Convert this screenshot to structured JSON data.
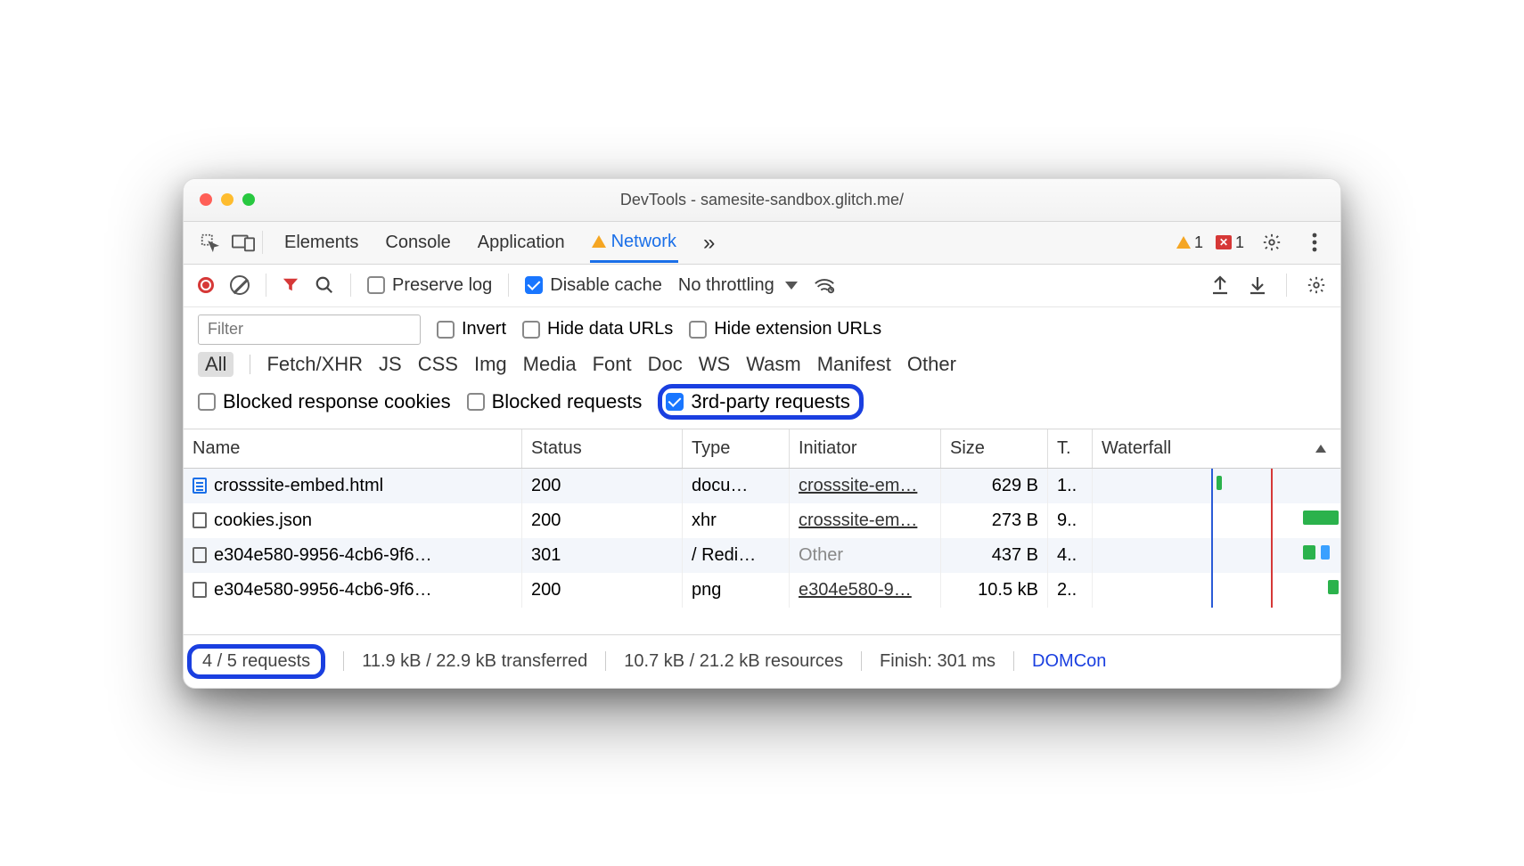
{
  "window": {
    "title": "DevTools - samesite-sandbox.glitch.me/"
  },
  "tabs": {
    "items": [
      "Elements",
      "Console",
      "Application",
      "Network"
    ],
    "active": 3,
    "overflow": "»"
  },
  "tabbar_status": {
    "warn_count": "1",
    "error_count": "1"
  },
  "toolbar": {
    "preserve_log": "Preserve log",
    "disable_cache": "Disable cache",
    "throttling": "No throttling"
  },
  "filterbar": {
    "placeholder": "Filter",
    "invert": "Invert",
    "hide_data": "Hide data URLs",
    "hide_ext": "Hide extension URLs"
  },
  "type_filters": [
    "All",
    "Fetch/XHR",
    "JS",
    "CSS",
    "Img",
    "Media",
    "Font",
    "Doc",
    "WS",
    "Wasm",
    "Manifest",
    "Other"
  ],
  "advanced_filters": {
    "blocked_cookies": "Blocked response cookies",
    "blocked_requests": "Blocked requests",
    "third_party": "3rd-party requests"
  },
  "columns": {
    "name": "Name",
    "status": "Status",
    "type": "Type",
    "initiator": "Initiator",
    "size": "Size",
    "time": "T.",
    "waterfall": "Waterfall"
  },
  "rows": [
    {
      "icon": "doc",
      "name": "crosssite-embed.html",
      "status": "200",
      "type": "docu…",
      "initiator": "crosssite-em…",
      "initiator_link": true,
      "size": "629 B",
      "time": "1.."
    },
    {
      "icon": "blank",
      "name": "cookies.json",
      "status": "200",
      "type": "xhr",
      "initiator": "crosssite-em…",
      "initiator_link": true,
      "size": "273 B",
      "time": "9.."
    },
    {
      "icon": "blank",
      "name": "e304e580-9956-4cb6-9f6…",
      "status": "301",
      "type": "/ Redi…",
      "initiator": "Other",
      "initiator_link": false,
      "size": "437 B",
      "time": "4.."
    },
    {
      "icon": "blank",
      "name": "e304e580-9956-4cb6-9f6…",
      "status": "200",
      "type": "png",
      "initiator": "e304e580-9…",
      "initiator_link": true,
      "size": "10.5 kB",
      "time": "2.."
    }
  ],
  "status": {
    "requests": "4 / 5 requests",
    "transferred": "11.9 kB / 22.9 kB transferred",
    "resources": "10.7 kB / 21.2 kB resources",
    "finish": "Finish: 301 ms",
    "domcontent": "DOMCon"
  }
}
